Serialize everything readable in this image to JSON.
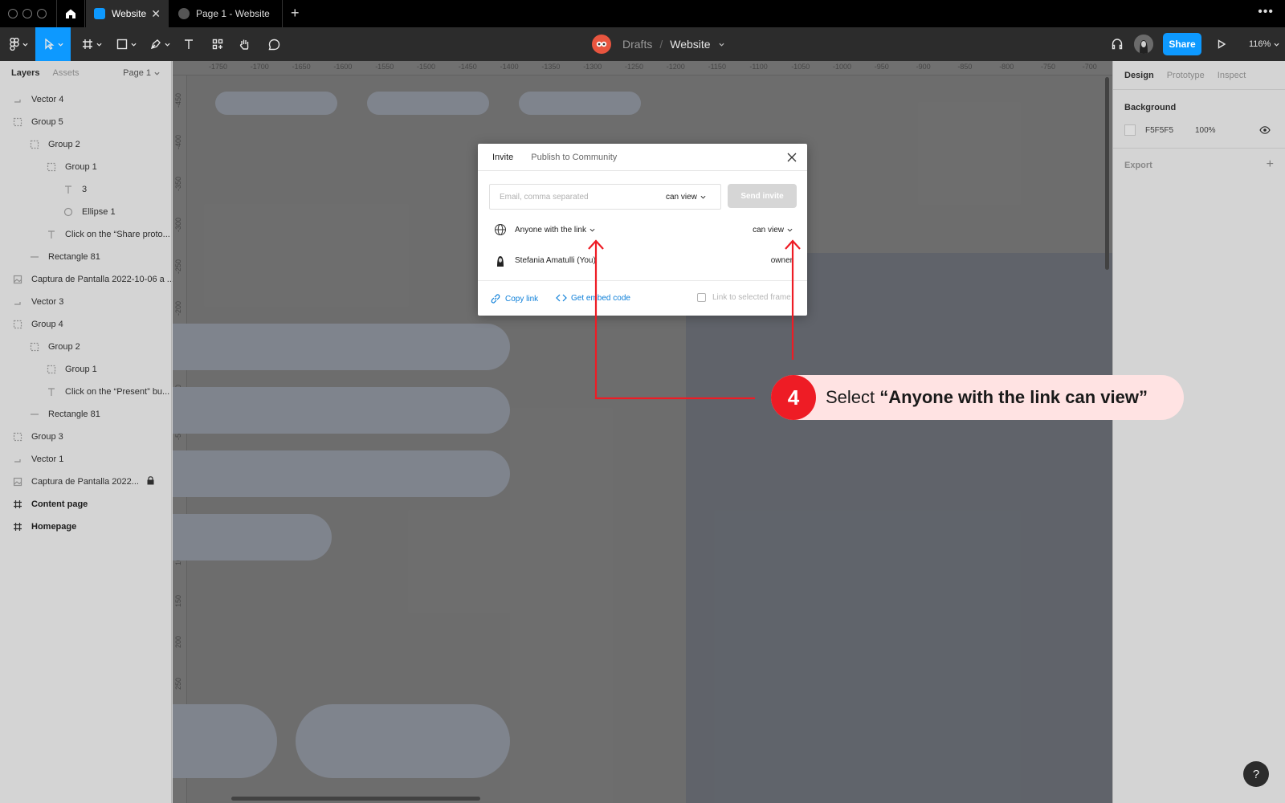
{
  "tabs": {
    "active": "Website",
    "second": "Page 1 - Website",
    "close_glyph": "✕",
    "new_glyph": "+",
    "more_glyph": "•••"
  },
  "toolbar": {
    "breadcrumb_drafts": "Drafts",
    "breadcrumb_sep": "/",
    "breadcrumb_file": "Website",
    "share_label": "Share",
    "zoom": "116%"
  },
  "left_panel": {
    "tab_layers": "Layers",
    "tab_assets": "Assets",
    "page": "Page 1",
    "layers": [
      {
        "name": "Vector 4",
        "icon": "vector-icon",
        "indent": 0,
        "bold": false
      },
      {
        "name": "Group 5",
        "icon": "group-icon",
        "indent": 0,
        "bold": false
      },
      {
        "name": "Group 2",
        "icon": "group-icon",
        "indent": 1,
        "bold": false
      },
      {
        "name": "Group 1",
        "icon": "group-icon",
        "indent": 2,
        "bold": false
      },
      {
        "name": "3",
        "icon": "text-icon",
        "indent": 3,
        "bold": false
      },
      {
        "name": "Ellipse 1",
        "icon": "ellipse-icon",
        "indent": 3,
        "bold": false
      },
      {
        "name": "Click on the “Share proto...",
        "icon": "text-icon",
        "indent": 2,
        "bold": false
      },
      {
        "name": "Rectangle 81",
        "icon": "line-icon",
        "indent": 1,
        "bold": false
      },
      {
        "name": "Captura de Pantalla 2022-10-06 a ...",
        "icon": "image-icon",
        "indent": 0,
        "bold": false
      },
      {
        "name": "Vector 3",
        "icon": "vector-icon",
        "indent": 0,
        "bold": false
      },
      {
        "name": "Group 4",
        "icon": "group-icon",
        "indent": 0,
        "bold": false
      },
      {
        "name": "Group 2",
        "icon": "group-icon",
        "indent": 1,
        "bold": false
      },
      {
        "name": "Group 1",
        "icon": "group-icon",
        "indent": 2,
        "bold": false
      },
      {
        "name": "Click on the “Present” bu...",
        "icon": "text-icon",
        "indent": 2,
        "bold": false
      },
      {
        "name": "Rectangle 81",
        "icon": "line-icon",
        "indent": 1,
        "bold": false
      },
      {
        "name": "Group 3",
        "icon": "group-icon",
        "indent": 0,
        "bold": false
      },
      {
        "name": "Vector 1",
        "icon": "vector-icon",
        "indent": 0,
        "bold": false
      },
      {
        "name": "Captura de Pantalla 2022...",
        "icon": "image-icon",
        "indent": 0,
        "bold": false,
        "locked": true
      },
      {
        "name": "Content page",
        "icon": "frame-icon",
        "indent": 0,
        "bold": true
      },
      {
        "name": "Homepage",
        "icon": "frame-icon",
        "indent": 0,
        "bold": true
      }
    ]
  },
  "ruler": {
    "top": [
      "-1750",
      "-1700",
      "-1650",
      "-1600",
      "-1550",
      "-1500",
      "-1450",
      "-1400",
      "-1350",
      "-1300",
      "-1250",
      "-1200",
      "-1150",
      "-1100",
      "-1050",
      "-1000",
      "-950",
      "-900",
      "-850",
      "-800",
      "-750",
      "-700"
    ],
    "left": [
      "-450",
      "-400",
      "-350",
      "-300",
      "-250",
      "-200",
      "-150",
      "-100",
      "-50",
      "0",
      "50",
      "100",
      "150",
      "200",
      "250",
      "300",
      "350",
      "400"
    ]
  },
  "right_panel": {
    "tab_design": "Design",
    "tab_prototype": "Prototype",
    "tab_inspect": "Inspect",
    "background_title": "Background",
    "bg_hex": "F5F5F5",
    "bg_opacity": "100%",
    "export_title": "Export",
    "export_plus": "+"
  },
  "modal": {
    "tab_invite": "Invite",
    "tab_publish": "Publish to Community",
    "email_placeholder": "Email, comma separated",
    "email_permission": "can view",
    "send_label": "Send invite",
    "link_access": "Anyone with the link",
    "link_permission": "can view",
    "owner_name": "Stefania Amatulli (You)",
    "owner_role": "owner",
    "copy_link": "Copy link",
    "embed_code": "Get embed code",
    "link_frame": "Link to selected frame"
  },
  "annotation": {
    "step": "4",
    "prefix": "Select ",
    "strong": "“Anyone with the link can view”",
    "color": "#ee1c25"
  },
  "help_glyph": "?"
}
